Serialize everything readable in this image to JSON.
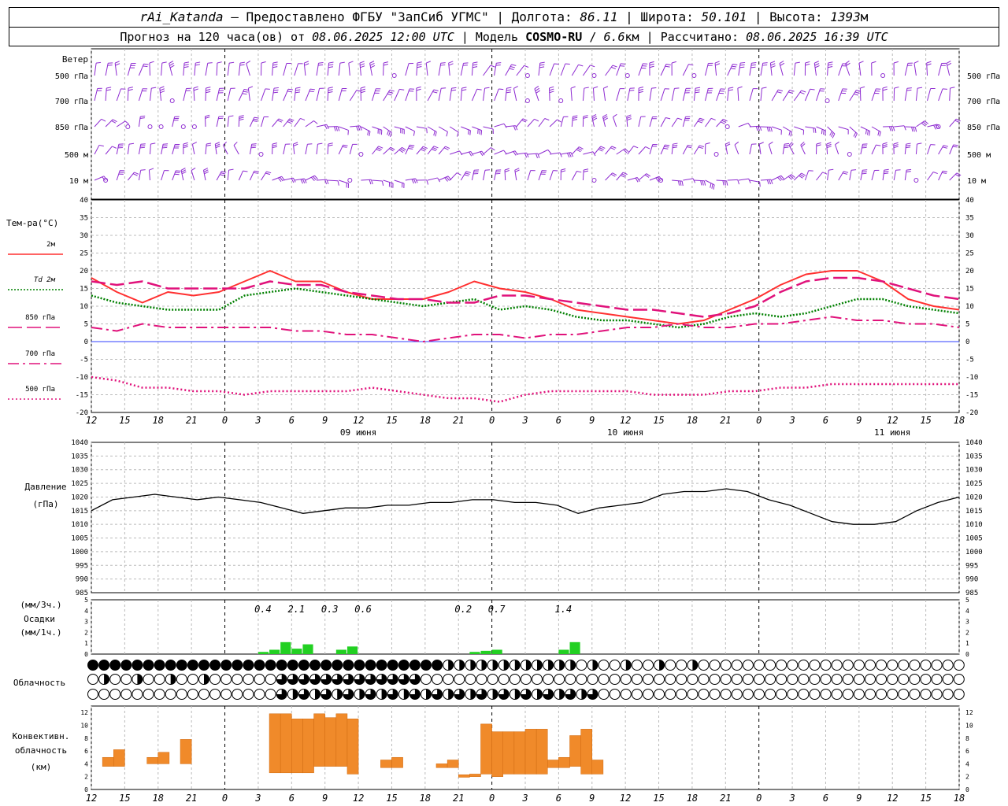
{
  "header": {
    "station": "rAi_Katanda",
    "provider": "Предоставлено ФГБУ \"ЗапСиб УГМС\"",
    "lon_label": "Долгота:",
    "lon": "86.11",
    "lat_label": "Широта:",
    "lat": "50.101",
    "alt_label": "Высота:",
    "alt": "1393",
    "alt_unit": "м",
    "forecast_label": "Прогноз на 120 часа(ов) от",
    "forecast_time": "08.06.2025 12:00 UTC",
    "model_label": "Модель",
    "model_name": "COSMO-RU",
    "model_res": "6.6",
    "model_res_unit": "км",
    "calc_label": "Рассчитано:",
    "calc_time": "08.06.2025 16:39 UTC"
  },
  "chart_data": [
    {
      "type": "wind-barbs",
      "title": "Ветер",
      "levels": [
        "500 гПа",
        "700 гПа",
        "850 гПа",
        "500 м",
        "10  м"
      ],
      "color": "#8e2bd1"
    },
    {
      "type": "line",
      "title": "Тем-ра(°C)",
      "ylim": [
        -20,
        40
      ],
      "yticks": [
        -20,
        -15,
        -10,
        -5,
        0,
        5,
        10,
        15,
        20,
        25,
        30,
        35,
        40
      ],
      "x_hours": [
        0,
        3,
        6,
        9,
        12,
        15,
        18,
        21,
        24,
        27,
        30,
        33,
        36,
        39,
        42,
        45,
        48,
        51,
        54,
        57,
        60,
        63,
        66,
        69,
        72,
        75,
        78
      ],
      "series": [
        {
          "name": "2м",
          "color": "#ff3030",
          "style": "solid",
          "values": [
            18,
            14,
            11,
            14,
            13,
            14,
            17,
            20,
            17,
            17,
            14,
            12,
            12,
            12,
            14,
            17,
            15,
            14,
            12,
            9,
            8,
            7,
            6,
            5,
            6,
            9,
            12,
            16,
            19,
            20,
            20,
            17,
            12,
            10,
            9
          ]
        },
        {
          "name": "Td  2м",
          "color": "#008000",
          "style": "dotted",
          "values": [
            13,
            11,
            10,
            9,
            9,
            9,
            13,
            14,
            15,
            14,
            13,
            12,
            11,
            10,
            11,
            12,
            9,
            10,
            9,
            7,
            6,
            6,
            5,
            4,
            5,
            7,
            8,
            7,
            8,
            10,
            12,
            12,
            10,
            9,
            8
          ]
        },
        {
          "name": "850 гПа",
          "color": "#e0127b",
          "style": "long-dash",
          "values": [
            17,
            16,
            17,
            15,
            15,
            15,
            15,
            17,
            16,
            16,
            14,
            13,
            12,
            12,
            11,
            11,
            13,
            13,
            12,
            11,
            10,
            9,
            9,
            8,
            7,
            8,
            10,
            14,
            17,
            18,
            18,
            17,
            15,
            13,
            12
          ]
        },
        {
          "name": "700 гПа",
          "color": "#e0127b",
          "style": "dash-dot",
          "values": [
            4,
            3,
            5,
            4,
            4,
            4,
            4,
            4,
            3,
            3,
            2,
            2,
            1,
            0,
            1,
            2,
            2,
            1,
            2,
            2,
            3,
            4,
            4,
            5,
            4,
            4,
            5,
            5,
            6,
            7,
            6,
            6,
            5,
            5,
            4
          ]
        },
        {
          "name": "500 гПа",
          "color": "#e0127b",
          "style": "fine-dot",
          "values": [
            -10,
            -11,
            -13,
            -13,
            -14,
            -14,
            -15,
            -14,
            -14,
            -14,
            -14,
            -13,
            -14,
            -15,
            -16,
            -16,
            -17,
            -15,
            -14,
            -14,
            -14,
            -14,
            -15,
            -15,
            -15,
            -14,
            -14,
            -13,
            -13,
            -12,
            -12,
            -12,
            -12,
            -12,
            -12
          ]
        }
      ]
    },
    {
      "type": "line",
      "title": "Давление",
      "ylabel": "(гПа)",
      "ylim": [
        985,
        1040
      ],
      "yticks": [
        985,
        990,
        995,
        1000,
        1005,
        1010,
        1015,
        1020,
        1025,
        1030,
        1035,
        1040
      ],
      "series": [
        {
          "name": "Давление",
          "color": "#000000",
          "values": [
            1015,
            1019,
            1020,
            1021,
            1020,
            1019,
            1020,
            1019,
            1018,
            1016,
            1014,
            1015,
            1016,
            1016,
            1017,
            1017,
            1018,
            1018,
            1019,
            1019,
            1018,
            1018,
            1017,
            1014,
            1016,
            1017,
            1018,
            1021,
            1022,
            1022,
            1023,
            1022,
            1019,
            1017,
            1014,
            1011,
            1010,
            1010,
            1011,
            1015,
            1018,
            1020
          ]
        }
      ]
    },
    {
      "type": "bar",
      "title": "Осадки",
      "ylabel_top": "(мм/3ч.)",
      "ylabel_bottom": "(мм/1ч.)",
      "ylim": [
        0,
        5
      ],
      "yticks": [
        0,
        1,
        2,
        3,
        4,
        5
      ],
      "color": "#22d022",
      "totals": [
        {
          "hour": 15,
          "label": "0.4"
        },
        {
          "hour": 18,
          "label": "2.1"
        },
        {
          "hour": 21,
          "label": "0.3"
        },
        {
          "hour": 24,
          "label": "0.6"
        },
        {
          "hour": 33,
          "label": "0.2"
        },
        {
          "hour": 36,
          "label": "0.7"
        },
        {
          "hour": 42,
          "label": "1.4"
        }
      ],
      "hourly": [
        {
          "hour": 16,
          "value": 0.2
        },
        {
          "hour": 17,
          "value": 0.4
        },
        {
          "hour": 18,
          "value": 1.1
        },
        {
          "hour": 19,
          "value": 0.5
        },
        {
          "hour": 20,
          "value": 0.9
        },
        {
          "hour": 23,
          "value": 0.4
        },
        {
          "hour": 24,
          "value": 0.7
        },
        {
          "hour": 35,
          "value": 0.2
        },
        {
          "hour": 36,
          "value": 0.3
        },
        {
          "hour": 37,
          "value": 0.4
        },
        {
          "hour": 43,
          "value": 0.4
        },
        {
          "hour": 44,
          "value": 1.1
        }
      ]
    },
    {
      "type": "cloud-cover-symbols",
      "title": "Облачность",
      "rows": 3
    },
    {
      "type": "bar",
      "title": "Конвективн.\nоблачность\n(км)",
      "title_lines": [
        "Конвективн.",
        "облачность",
        "(км)"
      ],
      "ylim": [
        0,
        13
      ],
      "yticks": [
        0,
        2,
        4,
        6,
        8,
        10,
        12
      ],
      "color": "#f08a2a",
      "ranges": [
        {
          "hour": 2,
          "base": 3.6,
          "top": 5.0
        },
        {
          "hour": 3,
          "base": 3.6,
          "top": 6.2
        },
        {
          "hour": 6,
          "base": 4.0,
          "top": 5.0
        },
        {
          "hour": 7,
          "base": 4.0,
          "top": 5.8
        },
        {
          "hour": 9,
          "base": 4.0,
          "top": 7.8
        },
        {
          "hour": 17,
          "base": 2.6,
          "top": 11.8
        },
        {
          "hour": 18,
          "base": 2.6,
          "top": 11.8
        },
        {
          "hour": 19,
          "base": 2.6,
          "top": 11.0
        },
        {
          "hour": 20,
          "base": 2.6,
          "top": 11.0
        },
        {
          "hour": 21,
          "base": 3.6,
          "top": 11.8
        },
        {
          "hour": 22,
          "base": 3.6,
          "top": 11.2
        },
        {
          "hour": 23,
          "base": 3.6,
          "top": 11.8
        },
        {
          "hour": 24,
          "base": 2.4,
          "top": 11.0
        },
        {
          "hour": 27,
          "base": 3.4,
          "top": 4.6
        },
        {
          "hour": 28,
          "base": 3.4,
          "top": 5.0
        },
        {
          "hour": 32,
          "base": 3.4,
          "top": 4.0
        },
        {
          "hour": 33,
          "base": 3.4,
          "top": 4.6
        },
        {
          "hour": 34,
          "base": 1.9,
          "top": 2.3
        },
        {
          "hour": 35,
          "base": 2.0,
          "top": 2.4
        },
        {
          "hour": 36,
          "base": 2.4,
          "top": 10.2
        },
        {
          "hour": 37,
          "base": 2.0,
          "top": 9.0
        },
        {
          "hour": 38,
          "base": 2.4,
          "top": 9.0
        },
        {
          "hour": 39,
          "base": 2.4,
          "top": 9.0
        },
        {
          "hour": 40,
          "base": 2.4,
          "top": 9.4
        },
        {
          "hour": 41,
          "base": 2.4,
          "top": 9.4
        },
        {
          "hour": 42,
          "base": 3.4,
          "top": 4.6
        },
        {
          "hour": 43,
          "base": 3.4,
          "top": 5.0
        },
        {
          "hour": 44,
          "base": 3.6,
          "top": 8.4
        },
        {
          "hour": 45,
          "base": 2.4,
          "top": 9.4
        },
        {
          "hour": 46,
          "base": 2.4,
          "top": 4.6
        }
      ]
    }
  ],
  "time_axis": {
    "ticks": [
      "12",
      "15",
      "18",
      "21",
      "0",
      "3",
      "6",
      "9",
      "12",
      "15",
      "18",
      "21",
      "0",
      "3",
      "6",
      "9",
      "12",
      "15",
      "18",
      "21",
      "0",
      "3",
      "6",
      "9",
      "12",
      "15",
      "18"
    ],
    "dates": [
      {
        "tick_index": 8,
        "label": "09 июня"
      },
      {
        "tick_index": 16,
        "label": "10 июня"
      },
      {
        "tick_index": 24,
        "label": "11 июня"
      }
    ]
  },
  "legend": {
    "temp_title": "Тем-ра(°C)",
    "items": [
      "2м",
      "Td  2м",
      "850 гПа",
      "700 гПа",
      "500 гПа"
    ]
  }
}
